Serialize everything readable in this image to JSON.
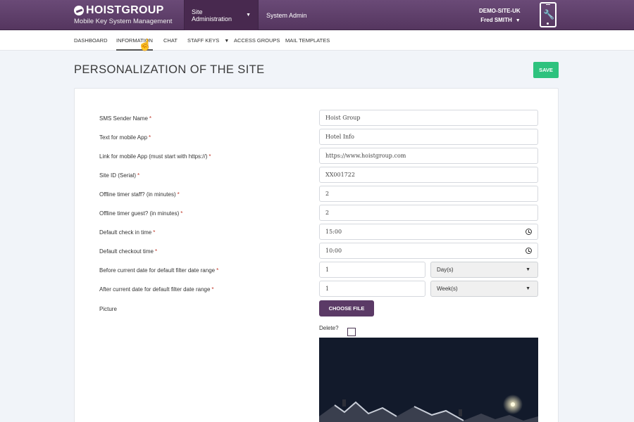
{
  "brand": {
    "name": "HOISTGROUP",
    "subtitle": "Mobile Key System Management"
  },
  "topnav": [
    {
      "label": "Site Administration",
      "caret": "▼"
    },
    {
      "label": "System Admin"
    }
  ],
  "user": {
    "site": "DEMO-SITE-UK",
    "name": "Fred SMITH",
    "caret": "▼"
  },
  "subnav": [
    "DASHBOARD",
    "INFORMATION",
    "CHAT",
    "STAFF KEYS",
    "ACCESS GROUPS",
    "MAIL TEMPLATES"
  ],
  "subnav_caret": "▼",
  "page": {
    "title": "PERSONALIZATION OF THE SITE",
    "save_label": "SAVE"
  },
  "form": {
    "required_marker": "*",
    "sms_sender_name": {
      "label": "SMS Sender Name",
      "value": "Hoist Group"
    },
    "mobile_app_text": {
      "label": "Text for mobile App",
      "value": "Hotel Info"
    },
    "mobile_app_link": {
      "label": "Link for mobile App (must start with https://)",
      "value": "https://www.hoistgroup.com"
    },
    "site_id": {
      "label": "Site ID (Serial)",
      "value": "XX001722"
    },
    "offline_timer_staff": {
      "label": "Offline timer staff? (in minutes)",
      "value": "2"
    },
    "offline_timer_guest": {
      "label": "Offline timer guest? (in minutes)",
      "value": "2"
    },
    "default_checkin": {
      "label": "Default check in time",
      "value": "15:00"
    },
    "default_checkout": {
      "label": "Default checkout time",
      "value": "10:00"
    },
    "before_range": {
      "label": "Before current date for default filter date range",
      "value": "1",
      "unit": "Day(s)"
    },
    "after_range": {
      "label": "After current date for default filter date range",
      "value": "1",
      "unit": "Week(s)"
    },
    "picture": {
      "label": "Picture",
      "choose_label": "CHOOSE FILE",
      "delete_label": "Delete?"
    }
  },
  "colors": {
    "header": "#5c3d66",
    "save": "#2ec27e",
    "choose_file": "#5b3a66",
    "required": "#c0392b"
  },
  "icons": [
    "phone-key-icon",
    "clock-icon",
    "dropdown-arrow-icon",
    "hand-cursor-icon"
  ]
}
